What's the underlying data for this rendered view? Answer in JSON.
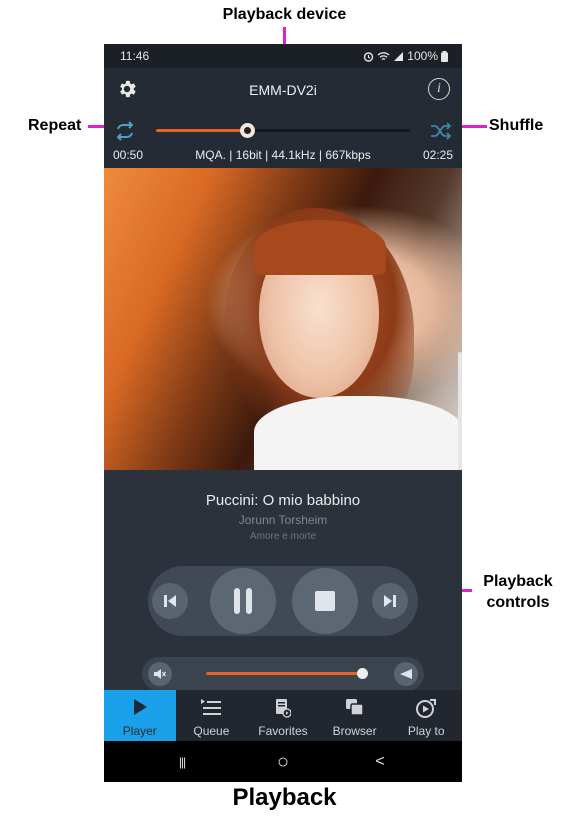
{
  "annotations": {
    "playback_device": "Playback device",
    "repeat": "Repeat",
    "shuffle": "Shuffle",
    "controls_line1": "Playback",
    "controls_line2": "controls",
    "caption": "Playback"
  },
  "status_bar": {
    "time": "11:46",
    "battery": "100%",
    "icons": [
      "alarm-icon",
      "wifi-icon",
      "signal-icon",
      "battery-icon"
    ]
  },
  "header": {
    "device_name": "EMM-DV2i",
    "left_icon": "gear-icon",
    "right_icon": "info-icon",
    "info_glyph": "i"
  },
  "playback": {
    "elapsed": "00:50",
    "total": "02:25",
    "format": "MQA. | 16bit | 44.1kHz | 667kbps",
    "progress": 0.36
  },
  "track": {
    "title": "Puccini: O mio babbino",
    "artist": "Jorunn Torsheim",
    "album": "Amore e morte"
  },
  "controls": [
    "previous-icon",
    "pause-icon",
    "stop-icon",
    "next-icon"
  ],
  "volume": {
    "level": 0.99,
    "left_icon": "mute-icon",
    "right_icon": "volume-icon"
  },
  "nav": {
    "items": [
      {
        "label": "Player",
        "icon": "play-icon",
        "active": true
      },
      {
        "label": "Queue",
        "icon": "queue-icon",
        "active": false
      },
      {
        "label": "Favorites",
        "icon": "favorites-icon",
        "active": false
      },
      {
        "label": "Browser",
        "icon": "browser-icon",
        "active": false
      },
      {
        "label": "Play to",
        "icon": "play-to-icon",
        "active": false
      }
    ]
  },
  "android_nav": {
    "home_glyph": "○",
    "back_glyph": "<",
    "recents_glyph": "|||"
  },
  "colors": {
    "accent": "#e8622c",
    "active_tab": "#1aa0e8",
    "annotation": "#e020c8",
    "background": "#2b323c"
  }
}
